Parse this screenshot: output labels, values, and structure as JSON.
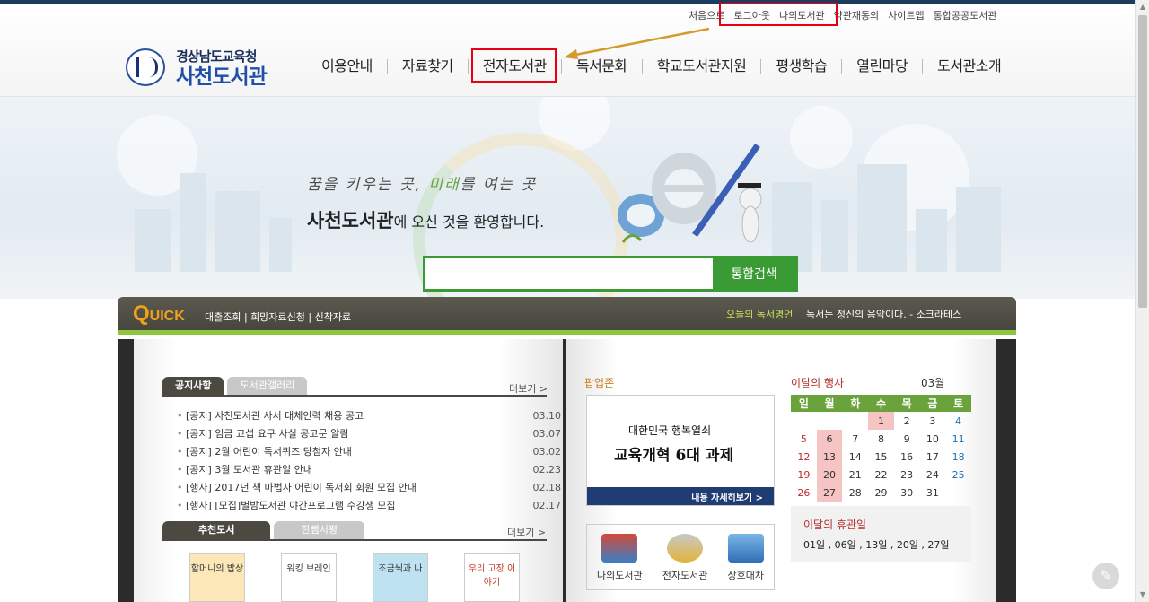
{
  "util_links": [
    "처음으로",
    "로그아웃",
    "나의도서관",
    "약관재동의",
    "사이트맵",
    "통합공공도서관"
  ],
  "logo": {
    "line1": "경상남도교육청",
    "line2": "사천도서관"
  },
  "gnb": [
    "이용안내",
    "자료찾기",
    "전자도서관",
    "독서문화",
    "학교도서관지원",
    "평생학습",
    "열린마당",
    "도서관소개"
  ],
  "hero": {
    "slogan_1": "꿈을 키우는 곳, ",
    "slogan_2": "미래",
    "slogan_3": "를 여는 곳",
    "welcome_bold": "사천도서관",
    "welcome_rest": "에 오신 것을 환영합니다."
  },
  "search": {
    "placeholder": "",
    "button": "통합검색"
  },
  "quick": {
    "logo_big": "Q",
    "logo_small": "UICK",
    "links": "대출조회 | 희망자료신청 | 신착자료",
    "quote_label": "오늘의 독서명언",
    "quote": "독서는 정신의 음악이다. - 소크라테스"
  },
  "notice": {
    "tab_on": "공지사항",
    "tab_off": "도서관갤러리",
    "more": "더보기 >",
    "items": [
      {
        "title": "[공지] 사천도서관 사서 대체인력 채용 공고",
        "date": "03.10"
      },
      {
        "title": "[공지] 임금 교섭 요구 사실 공고문 알림",
        "date": "03.07"
      },
      {
        "title": "[공지] 2월 어린이 독서퀴즈 당첨자 안내",
        "date": "03.02"
      },
      {
        "title": "[공지] 3월 도서관 휴관일 안내",
        "date": "02.23"
      },
      {
        "title": "[행사] 2017년 책 마법사 어린이 독서회 회원 모집 안내",
        "date": "02.18"
      },
      {
        "title": "[행사] [모집]별밤도서관 야간프로그램 수강생 모집",
        "date": "02.17"
      }
    ]
  },
  "books": {
    "tab_on": "추천도서",
    "tab_off": "한뼘서평",
    "more": "더보기 >",
    "covers": [
      "할머니의 밥상",
      "워킹 브레인",
      "조금씩과 나",
      "우리 고장 이야기"
    ]
  },
  "popup": {
    "heading": "팝업존",
    "line1": "대한민국 행복열쇠",
    "line2": "교육개혁 6대 과제",
    "bar": "내용 자세히보기 >"
  },
  "quicklinks": [
    "나의도서관",
    "전자도서관",
    "상호대차"
  ],
  "calendar": {
    "heading": "이달의 행사",
    "month": "03월",
    "weekdays": [
      "일",
      "월",
      "화",
      "수",
      "목",
      "금",
      "토"
    ],
    "weeks": [
      [
        "",
        "",
        "",
        "1",
        "2",
        "3",
        "4"
      ],
      [
        "5",
        "6",
        "7",
        "8",
        "9",
        "10",
        "11"
      ],
      [
        "12",
        "13",
        "14",
        "15",
        "16",
        "17",
        "18"
      ],
      [
        "19",
        "20",
        "21",
        "22",
        "23",
        "24",
        "25"
      ],
      [
        "26",
        "27",
        "28",
        "29",
        "30",
        "31",
        ""
      ]
    ],
    "holidays": [
      "1",
      "6",
      "13",
      "20",
      "27"
    ]
  },
  "closed": {
    "heading": "이달의 휴관일",
    "days": "01일 , 06일 , 13일 , 20일 , 27일"
  },
  "colors": {
    "accent_green": "#3a9b35",
    "highlight_red": "#e60012",
    "arrow": "#d49a2a",
    "navy": "#1d3b5c"
  }
}
